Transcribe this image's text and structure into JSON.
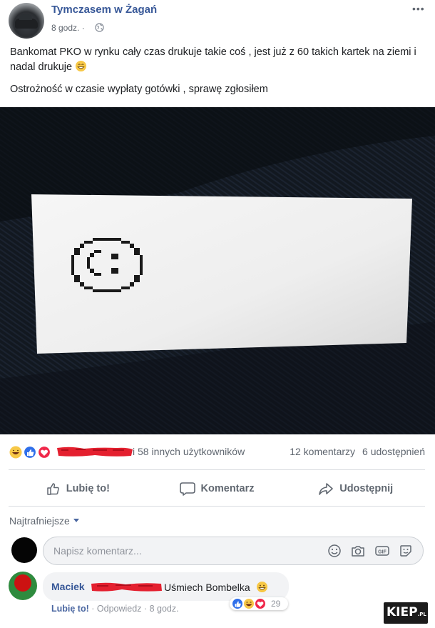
{
  "post": {
    "page_name": "Tymczasem w Żagań",
    "time": "8 godz. ·",
    "more": "•••",
    "text_line1": "Bankomat PKO w rynku cały czas drukuje takie coś , jest już z 60 takich kartek na ziemi i nadal drukuje",
    "text_line2": "Ostrożność w czasie wypłaty gotówki , sprawę zgłosiłem"
  },
  "reactions": {
    "others_text": "i 58 innych użytkowników",
    "comments": "12 komentarzy",
    "shares": "6 udostępnień"
  },
  "actions": {
    "like": "Lubię to!",
    "comment": "Komentarz",
    "share": "Udostępnij"
  },
  "comments": {
    "sort_label": "Najtrafniejsze",
    "input_placeholder": "Napisz komentarz...",
    "items": [
      {
        "author": "Maciek",
        "text": "Uśmiech Bombelka",
        "like": "Lubię to!",
        "reply": "Odpowiedz",
        "time": "8 godz.",
        "reaction_count": "29"
      }
    ]
  },
  "watermark": {
    "text": "KIEP",
    "suffix": ".PL"
  },
  "colors": {
    "link": "#385898",
    "secondary_text": "#606770",
    "divider": "#dadde1",
    "input_bg": "#f2f3f5"
  }
}
